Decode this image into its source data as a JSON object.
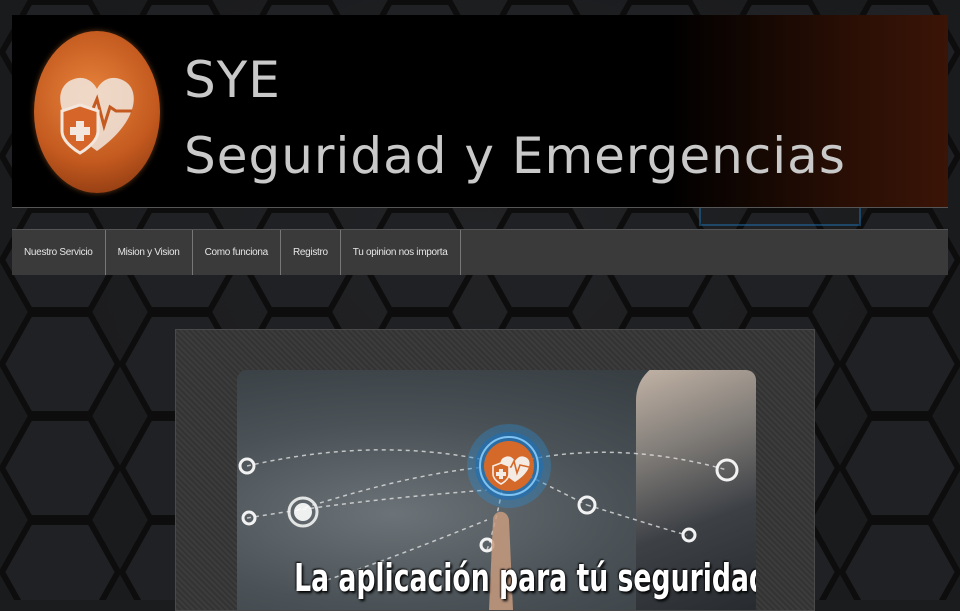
{
  "header": {
    "brand_short": "SYE",
    "brand_full": "Seguridad y Emergencias",
    "logo_icon": "heart-shield-icon"
  },
  "nav": {
    "items": [
      {
        "label": "Nuestro Servicio"
      },
      {
        "label": "Mision y Vision"
      },
      {
        "label": "Como funciona"
      },
      {
        "label": "Registro"
      },
      {
        "label": "Tu opinion nos importa"
      }
    ]
  },
  "slider": {
    "caption": "La aplicación para tú seguridad",
    "center_icon": "heart-shield-icon"
  },
  "colors": {
    "accent_orange": "#d5692a",
    "nav_bg": "#3a3a3a",
    "glow_blue": "#2a8fd8"
  }
}
